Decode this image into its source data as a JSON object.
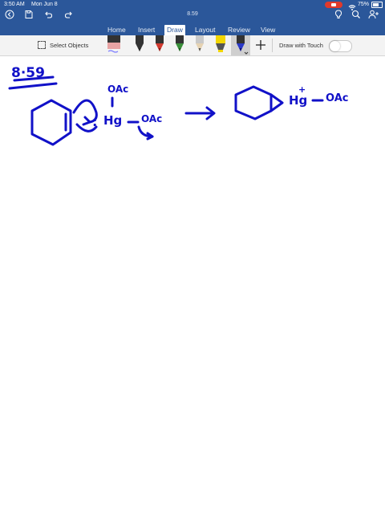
{
  "status_bar": {
    "time": "3:50 AM",
    "date": "Mon Jun 8",
    "battery": "75%"
  },
  "document": {
    "title": "8.59"
  },
  "tabs": [
    {
      "label": "Home"
    },
    {
      "label": "Insert"
    },
    {
      "label": "Draw",
      "active": true
    },
    {
      "label": "Layout"
    },
    {
      "label": "Review"
    },
    {
      "label": "View"
    }
  ],
  "ribbon": {
    "select_objects_label": "Select Objects",
    "draw_with_touch_label": "Draw with Touch",
    "draw_with_touch_on": false,
    "pens": [
      {
        "name": "eraser",
        "color": "#e8a3a3"
      },
      {
        "name": "black-pen",
        "color": "#222222"
      },
      {
        "name": "red-pen",
        "color": "#d13a2f"
      },
      {
        "name": "green-pen",
        "color": "#3a8f3a"
      },
      {
        "name": "pencil",
        "color": "#c9c9c9"
      },
      {
        "name": "highlighter",
        "color": "#f2d600"
      },
      {
        "name": "blue-pen",
        "color": "#2a39c8",
        "selected": true
      }
    ]
  },
  "ink": {
    "problem_number": "8·59",
    "reagent_top": "OAc",
    "reagent_hg": "Hg",
    "reagent_right": "OAc",
    "lone_pair": ":",
    "product_hg": "Hg",
    "product_charge": "+",
    "product_oac": "OAc",
    "ink_color": "#1111c8"
  }
}
